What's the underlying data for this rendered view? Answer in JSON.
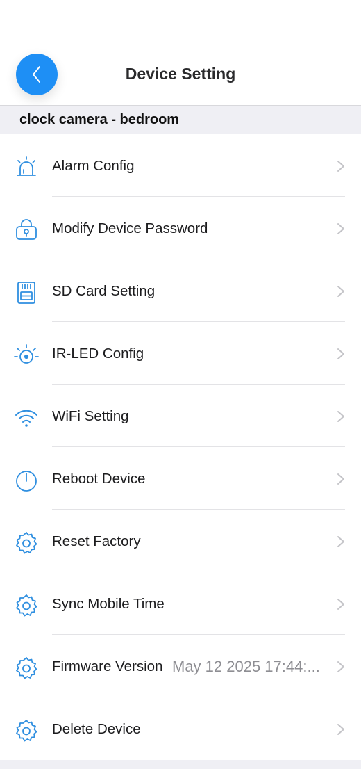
{
  "header": {
    "title": "Device Setting",
    "back_icon": "chevron-left-icon",
    "accent": "#1e8ff5"
  },
  "device": {
    "name": "clock camera - bedroom"
  },
  "items": [
    {
      "label": "Alarm Config",
      "icon": "alarm-light-icon"
    },
    {
      "label": "Modify Device Password",
      "icon": "lock-icon"
    },
    {
      "label": "SD Card Setting",
      "icon": "sd-card-icon"
    },
    {
      "label": "IR-LED Config",
      "icon": "led-light-icon"
    },
    {
      "label": "WiFi Setting",
      "icon": "wifi-icon"
    },
    {
      "label": "Reboot Device",
      "icon": "power-icon"
    },
    {
      "label": "Reset Factory",
      "icon": "gear-icon"
    },
    {
      "label": "Sync Mobile Time",
      "icon": "gear-icon"
    },
    {
      "label": "Firmware Version",
      "icon": "gear-icon",
      "value": "May 12 2025 17:44:..."
    },
    {
      "label": "Delete Device",
      "icon": "gear-icon"
    }
  ],
  "colors": {
    "icon": "#2f8fe0",
    "chevron": "#c4c4c8",
    "section_bg": "#efeff4"
  }
}
